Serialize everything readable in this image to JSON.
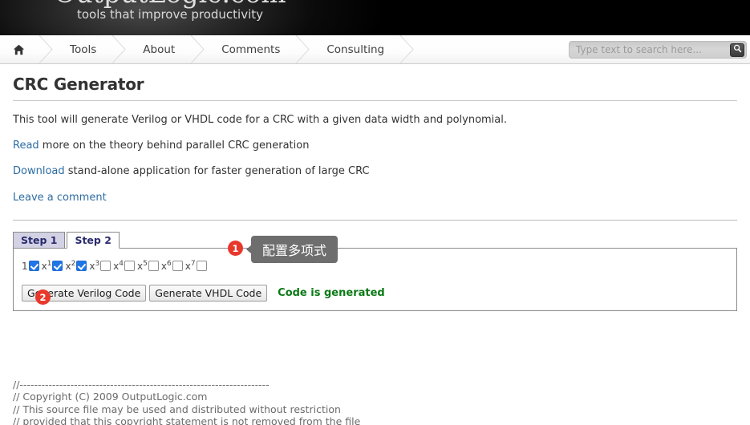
{
  "banner": {
    "logo_text": "OutputLogic.com",
    "tagline": "tools that improve productivity"
  },
  "nav": {
    "home_icon": "home-icon",
    "items": [
      {
        "label": "Tools"
      },
      {
        "label": "About"
      },
      {
        "label": "Comments"
      },
      {
        "label": "Consulting"
      }
    ]
  },
  "search": {
    "placeholder": "Type text to search here...",
    "value": "",
    "button_icon": "search-icon"
  },
  "page": {
    "title": "CRC Generator",
    "intro": "This tool will generate Verilog or VHDL code for a CRC with a given data width and polynomial.",
    "read_link": "Read",
    "read_rest": " more on the theory behind parallel CRC generation",
    "download_link": "Download",
    "download_rest": " stand-alone application for faster generation of large CRC",
    "comment_link": "Leave a comment"
  },
  "tabs": [
    {
      "label": "Step 1",
      "active": false
    },
    {
      "label": "Step 2",
      "active": true
    }
  ],
  "polynomial": {
    "terms": [
      {
        "label": "1",
        "checked": true
      },
      {
        "label": "x1",
        "checked": true
      },
      {
        "label": "x2",
        "checked": true
      },
      {
        "label": "x3",
        "checked": false
      },
      {
        "label": "x4",
        "checked": false
      },
      {
        "label": "x5",
        "checked": false
      },
      {
        "label": "x6",
        "checked": false
      },
      {
        "label": "x7",
        "checked": false
      }
    ]
  },
  "actions": {
    "verilog_button": "Generate Verilog Code",
    "vhdl_button": "Generate VHDL Code",
    "status": "Code is generated"
  },
  "annotations": {
    "badge_1": "1",
    "badge_2": "2",
    "callout_1": "配置多项式"
  },
  "colors": {
    "badge_red": "#e8382c",
    "callout_gray": "#6e6e6e",
    "status_green": "#0a7a14",
    "checkbox_blue": "#2176e6",
    "link_blue": "#2d6ca2",
    "tab_active_text": "#2a2a6e"
  },
  "code_output": "//---------------------------------------------------------------------\n// Copyright (C) 2009 OutputLogic.com\n// This source file may be used and distributed without restriction\n// provided that this copyright statement is not removed from the file\n// and that any derivative work contains the original copyright notice\n// and the associated disclaimer.\n//\n// THIS SOURCE FILE IS PROVIDED \"AS IS\" AND WITHOUT ANY EXPRESS\n// OR IMPLIED WARRANTIES, INCLUDING, WITHOUT LIMITATION, THE IMPLIED\n// WARRANTIES OF MERCHANTIBILITY AND FITNESS FOR A PARTICULAR PURPOSE."
}
